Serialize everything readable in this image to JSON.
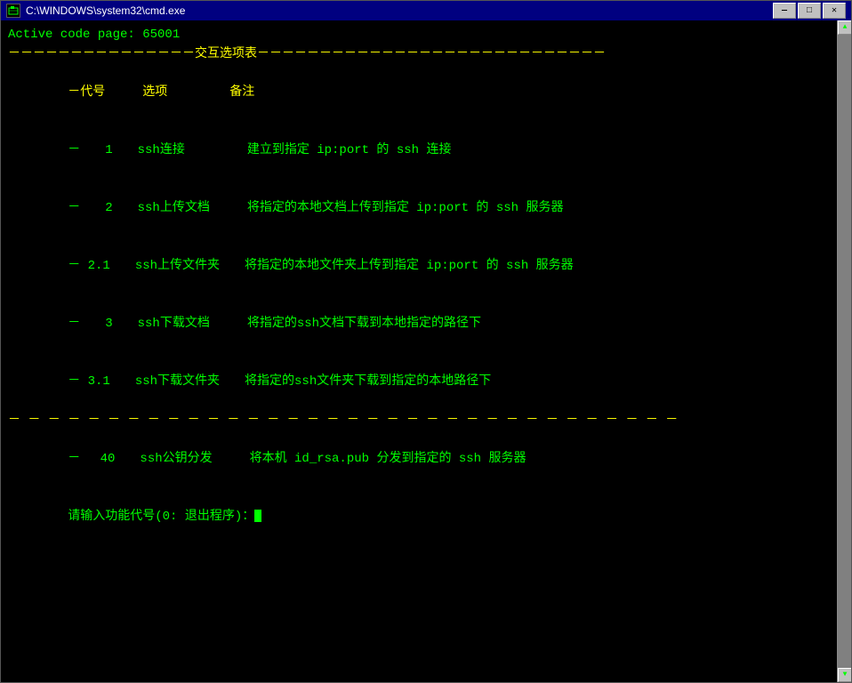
{
  "titlebar": {
    "icon": "C",
    "title": "C:\\WINDOWS\\system32\\cmd.exe",
    "minimize_label": "—",
    "maximize_label": "□",
    "close_label": "✕"
  },
  "terminal": {
    "active_code_line": "Active code page: 65001",
    "menu_title": "交互选项表",
    "header_code": "代号",
    "header_option": "选项",
    "header_desc": "备注",
    "separator_line": "－－－－－－－－－－－－－－－－－－－－－－－－－－－－－－－－－－－－－－－－",
    "items": [
      {
        "code": "1",
        "option": "ssh连接",
        "desc": "建立到指定 ip:port 的 ssh 连接"
      },
      {
        "code": "2",
        "option": "ssh上传文档",
        "desc": "将指定的本地文档上传到指定 ip:port 的 ssh 服务器"
      },
      {
        "code": "2.1",
        "option": "ssh上传文件夹",
        "desc": "将指定的本地文件夹上传到指定 ip:port 的 ssh 服务器"
      },
      {
        "code": "3",
        "option": "ssh下载文档",
        "desc": "将指定的ssh文档下载到本地指定的路径下"
      },
      {
        "code": "3.1",
        "option": "ssh下载文件夹",
        "desc": "将指定的ssh文件夹下载到指定的本地路径下"
      }
    ],
    "special_item": {
      "code": "40",
      "option": "ssh公钥分发",
      "desc": "将本机 id_rsa.pub 分发到指定的 ssh 服务器"
    },
    "prompt": "请输入功能代号(0: 退出程序)："
  }
}
